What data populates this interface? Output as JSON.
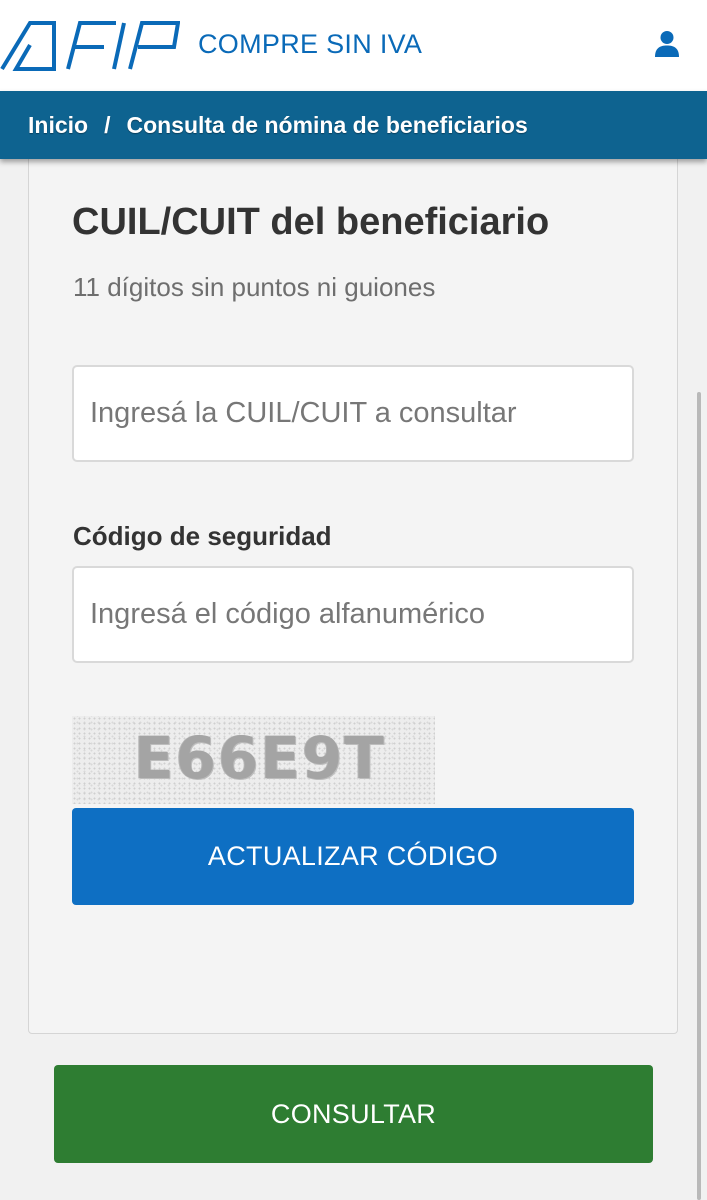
{
  "header": {
    "logo_text": "AFIP",
    "app_title": "COMPRE SIN IVA",
    "user_icon": "user-icon"
  },
  "breadcrumb": {
    "home": "Inicio",
    "separator": "/",
    "current": "Consulta de nómina de beneficiarios"
  },
  "form": {
    "title": "CUIL/CUIT del beneficiario",
    "hint": "11 dígitos sin puntos ni guiones",
    "cuil_input": {
      "placeholder": "Ingresá la CUIL/CUIT a consultar",
      "value": ""
    },
    "security_label": "Código de seguridad",
    "code_input": {
      "placeholder": "Ingresá el código alfanumérico",
      "value": ""
    },
    "captcha_text": "E66E9T",
    "refresh_button": "ACTUALIZAR CÓDIGO",
    "submit_button": "CONSULTAR"
  },
  "colors": {
    "brand_blue": "#0a6ab8",
    "breadcrumb_bg": "#0e6390",
    "refresh_button_bg": "#0e6fc3",
    "submit_button_bg": "#2e7d32"
  }
}
